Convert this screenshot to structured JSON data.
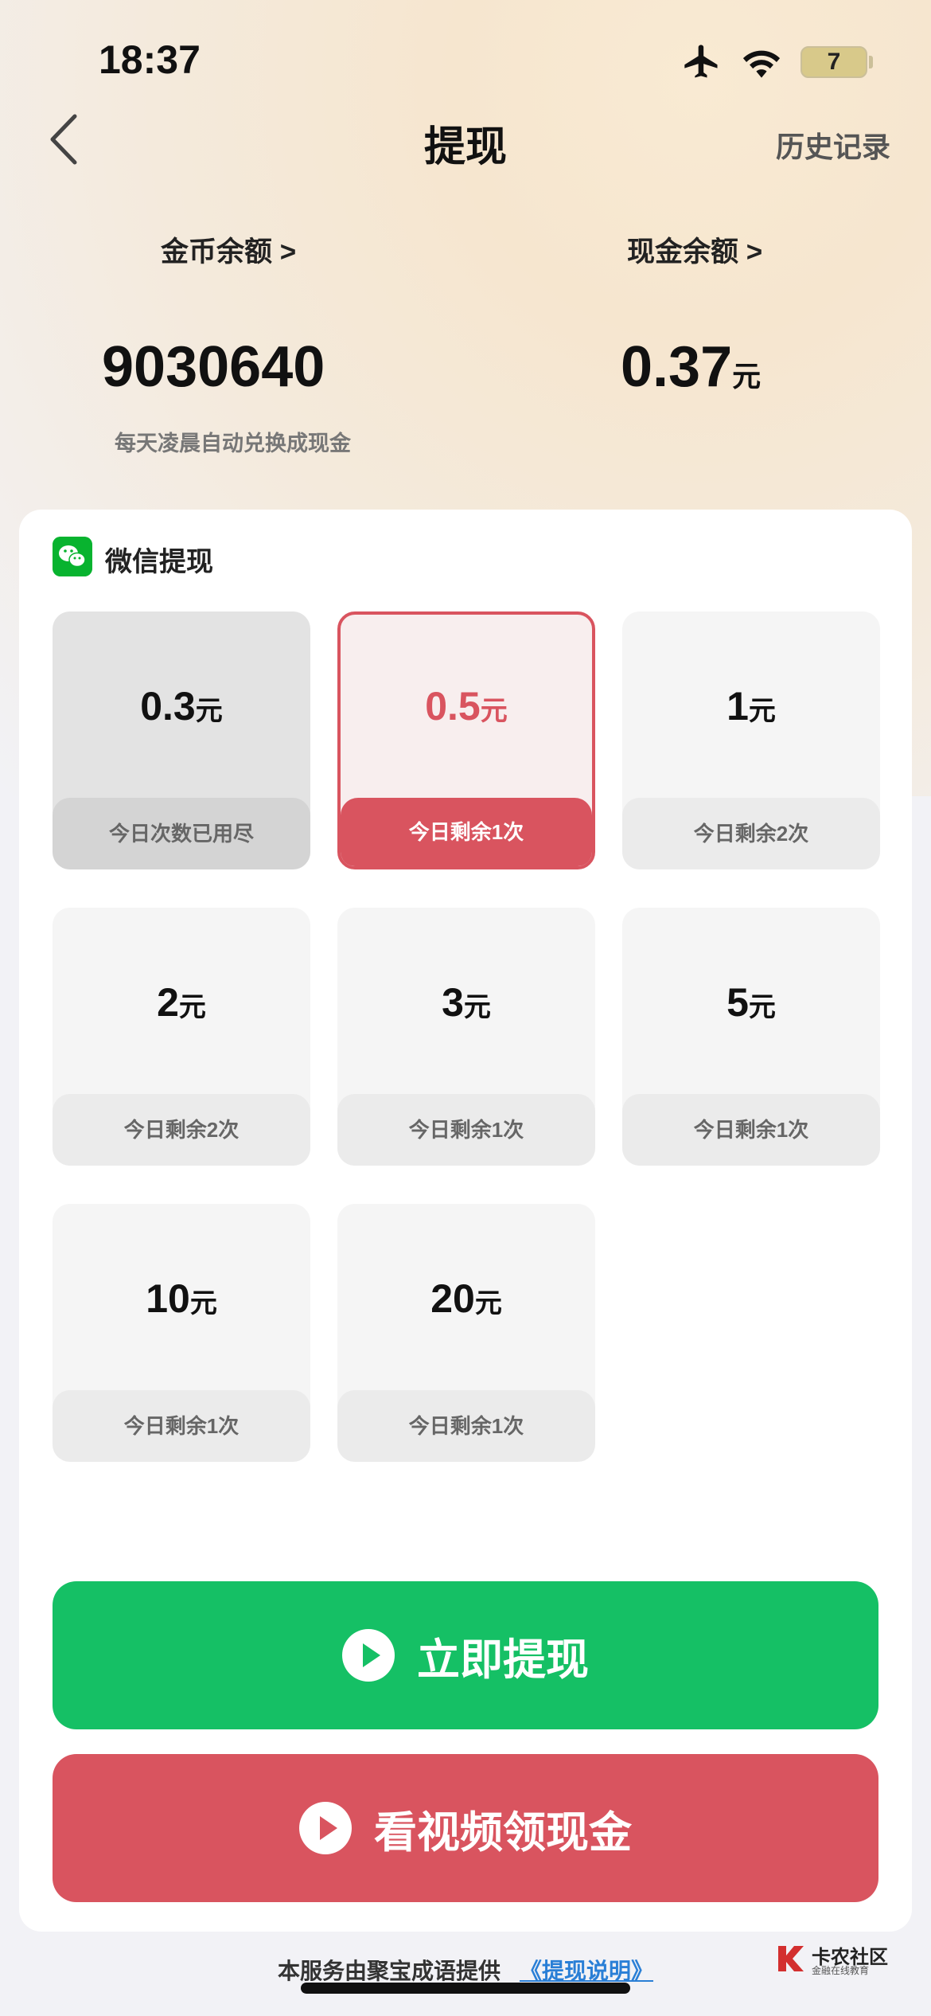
{
  "status_bar": {
    "time": "18:37",
    "battery": "7"
  },
  "nav": {
    "title": "提现",
    "history": "历史记录"
  },
  "balances": {
    "coins_label": "金币余额 >",
    "coins_value": "9030640",
    "coins_note": "每天凌晨自动兑换成现金",
    "cash_label": "现金余额 >",
    "cash_value": "0.37",
    "cash_unit": "元"
  },
  "withdraw": {
    "method": "微信提现",
    "unit": "元",
    "options": [
      {
        "amount": "0.3",
        "note": "今日次数已用尽",
        "state": "disabled"
      },
      {
        "amount": "0.5",
        "note": "今日剩余1次",
        "state": "selected"
      },
      {
        "amount": "1",
        "note": "今日剩余2次",
        "state": "normal"
      },
      {
        "amount": "2",
        "note": "今日剩余2次",
        "state": "normal"
      },
      {
        "amount": "3",
        "note": "今日剩余1次",
        "state": "normal"
      },
      {
        "amount": "5",
        "note": "今日剩余1次",
        "state": "normal"
      },
      {
        "amount": "10",
        "note": "今日剩余1次",
        "state": "normal"
      },
      {
        "amount": "20",
        "note": "今日剩余1次",
        "state": "normal"
      }
    ]
  },
  "buttons": {
    "withdraw_now": "立即提现",
    "watch_video": "看视频领现金"
  },
  "footer": {
    "text": "本服务由聚宝成语提供",
    "link": "《提现说明》"
  },
  "watermark": {
    "name": "卡农社区",
    "sub": "金融在线教育"
  },
  "colors": {
    "accent_red": "#d9545f",
    "accent_green": "#15c065",
    "wechat_green": "#08b32f"
  }
}
